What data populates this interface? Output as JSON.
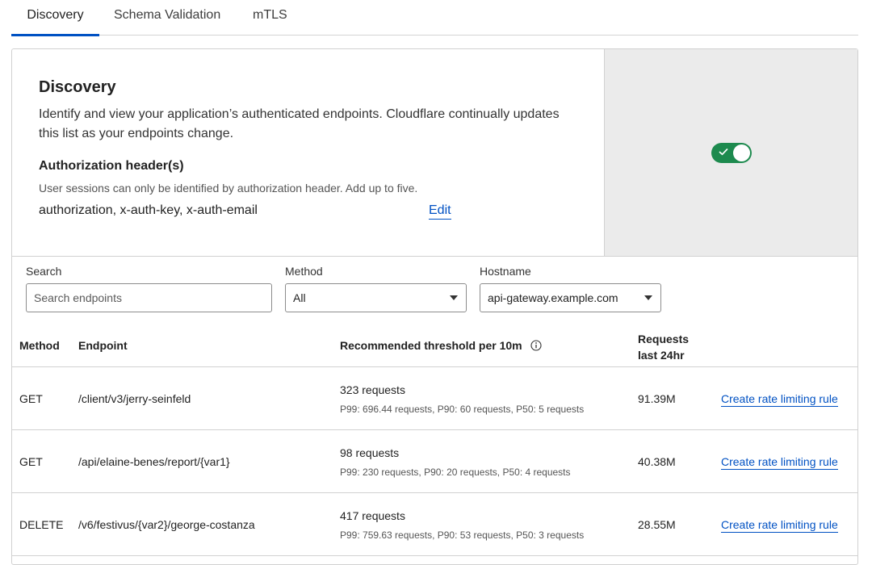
{
  "tabs": [
    {
      "label": "Discovery",
      "active": true
    },
    {
      "label": "Schema Validation",
      "active": false
    },
    {
      "label": "mTLS",
      "active": false
    }
  ],
  "discovery": {
    "title": "Discovery",
    "description": "Identify and view your application’s authenticated endpoints. Cloudflare continually updates this list as your endpoints change.",
    "auth_header_title": "Authorization header(s)",
    "auth_header_help": "User sessions can only be identified by authorization header. Add up to five.",
    "auth_headers_value": "authorization, x-auth-key, x-auth-email",
    "edit_label": "Edit",
    "toggle_on": true
  },
  "filters": {
    "search_label": "Search",
    "search_placeholder": "Search endpoints",
    "method_label": "Method",
    "method_value": "All",
    "hostname_label": "Hostname",
    "hostname_value": "api-gateway.example.com"
  },
  "table": {
    "headers": {
      "method": "Method",
      "endpoint": "Endpoint",
      "threshold": "Recommended threshold per 10m",
      "requests_line1": "Requests",
      "requests_line2": "last 24hr"
    },
    "action_label": "Create rate limiting rule",
    "rows": [
      {
        "method": "GET",
        "endpoint": "/client/v3/jerry-seinfeld",
        "threshold": "323 requests",
        "percentiles": "P99: 696.44 requests, P90: 60 requests, P50: 5 requests",
        "requests": "91.39M"
      },
      {
        "method": "GET",
        "endpoint": "/api/elaine-benes/report/{var1}",
        "threshold": "98 requests",
        "percentiles": "P99: 230 requests, P90: 20 requests, P50: 4 requests",
        "requests": "40.38M"
      },
      {
        "method": "DELETE",
        "endpoint": "/v6/festivus/{var2}/george-costanza",
        "threshold": "417 requests",
        "percentiles": "P99: 759.63 requests, P90: 53 requests, P50: 3 requests",
        "requests": "28.55M"
      }
    ]
  },
  "colors": {
    "accent": "#0051c3",
    "toggle": "#1d8a4e"
  }
}
